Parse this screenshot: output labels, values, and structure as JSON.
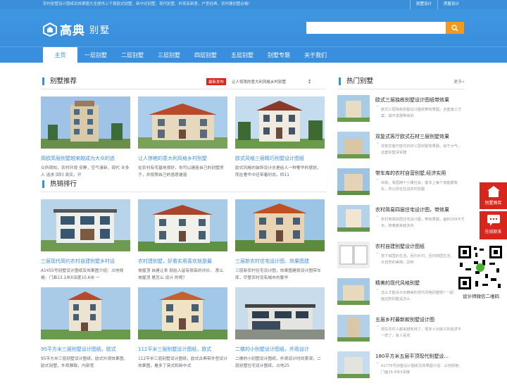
{
  "topbar": {
    "notice": "农村别墅设计图纸及效果图大全提供上千套欧式别墅、新中式别墅、现代别墅、外观有新意，户型经典，农村建别墅必看!",
    "links": [
      "别墅设计",
      "房屋设计"
    ]
  },
  "logo": {
    "brand": "高典",
    "sub": "别墅"
  },
  "search": {
    "placeholder": ""
  },
  "nav": [
    "主页",
    "一层别墅",
    "二层别墅",
    "三层别墅",
    "四层别墅",
    "五层别墅",
    "别墅专题",
    "关于我们"
  ],
  "recommend": {
    "title": "别墅推荐",
    "ticker_tag": "最新发布",
    "ticker_text": "让人惊艳的意大利风格乡村别墅",
    "cards": [
      {
        "title": "简欧高层别墅越来越成为大众的追",
        "desc": "众所周知，农村环境 安静，空气清新，现代 许多人 追求 回归 真实，开"
      },
      {
        "title": "让人惊艳的意大利风格乡村别墅",
        "desc": "在农村有宅基地很好，你可以建造自己的别墅房子，并按照自己的意愿建造"
      },
      {
        "title": "欧式风格三层精巧别墅设计图纸",
        "desc": "欧式风格的装饰设计总是给人一种奢华的感觉，而在奢华中还带着时尚。tб11"
      }
    ]
  },
  "hotsale": {
    "title": "热销排行",
    "cards": [
      {
        "title": "三层现代简约农村自建别墅乡村设",
        "desc": "A1455号别墅设计图纸及效果图介绍：占地规格：门面13.1米X深度10.6米 一"
      },
      {
        "title": "农村建别墅，好看实用喜欢就是最",
        "desc": "坡屋顶 自建让来 就给人留有很高的评价。 那么 坡屋顶 是怎么 设计 的呢?"
      },
      {
        "title": "三层新农村住宅设计图、效果图建",
        "desc": "三层新农村住宅设计图，效果图建筑设计图带车库，尽管农村没有城市的繁华"
      },
      {
        "title": "95平方米三层别墅设计图纸，欧式",
        "desc": "95平方米三层别墅设计图纸，欧式外观效果图，欧式别墅，外观雅致，内部宽"
      },
      {
        "title": "112平米三层别墅设计图纸，欧式",
        "desc": "112平米三层别墅设计图纸，欧式古典带外型设计效果图，看多了英式和新中式"
      },
      {
        "title": "二楼的小别墅设计图纸，外观设计",
        "desc": "二楼的小别墅设计图纸，外观设计时尚美观，二层别墅住宅设计图纸，占地25"
      }
    ]
  },
  "hot": {
    "title": "热门别墅",
    "more": "更多»",
    "items": [
      {
        "title": "欧式三层独栋别墅设计图纸带效果",
        "desc": "欧式三层独栋别墅设计图纸带效果图，全套施工方案，城市发展带来的"
      },
      {
        "title": "双复式客厅欧式石材三层别墅效果",
        "desc": "双复式客厅欧式石材三层别墅效果图，由于大气，这套别墅深受建"
      },
      {
        "title": "带车库的农村自营别墅,经济实用",
        "desc": "目前，我国两个小康社会，基本上每个家庭都有车，所以现在住进农村别墅"
      },
      {
        "title": "农村简易四层住宅设计图，带效果",
        "desc": "农村简易四层住宅设计图，带效果图，面积209平方米，随着越来越多的"
      },
      {
        "title": "农村自建别墅设计图纸",
        "desc": "放下城里的生活，回归乡村，回归田园生活，感受大自然的美丽，回到"
      },
      {
        "title": "精美的现代风格别墅",
        "desc": "怎么才能设计出精美的现代风格别墅呢? 一起看看下面这款别墅是怎么"
      },
      {
        "title": "五层乡村最新款别墅设计图",
        "desc": "现在农村人越来越有钱了，很多人对房子的追求不一样了，有人喜欢"
      },
      {
        "title": "180平方米五层平顶现代别墅设...",
        "desc": "A1776号别墅设计图纸及效果图介绍：占地规格：门面16.4米X深度"
      }
    ]
  },
  "float": {
    "gallery": "别墅图库",
    "contact": "在线联系",
    "qr_label": "设计师微信二维码"
  },
  "watermark": "高典别墅",
  "colors": {
    "primary": "#3a8ede",
    "accent": "#f39a1c",
    "red": "#d9261c"
  }
}
